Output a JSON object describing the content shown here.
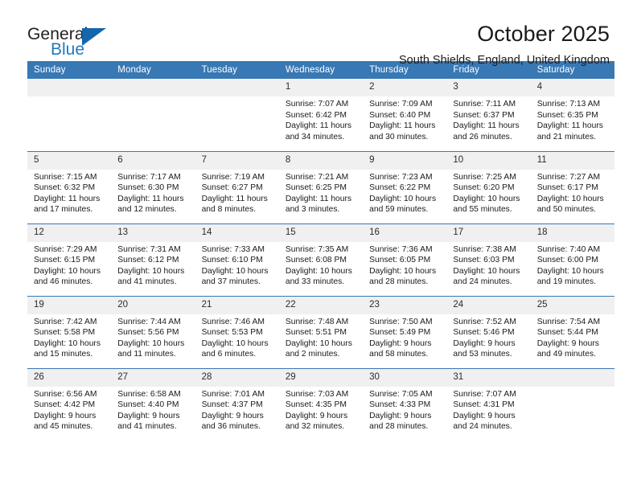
{
  "brand": {
    "name_top": "General",
    "name_bottom": "Blue",
    "accent_color": "#1567ab",
    "text_color": "#231f20"
  },
  "header": {
    "month_title": "October 2025",
    "location": "South Shields, England, United Kingdom"
  },
  "calendar": {
    "header_bg": "#3878b4",
    "header_text_color": "#ffffff",
    "daynumber_bg": "#f0f0f0",
    "weekdays": [
      "Sunday",
      "Monday",
      "Tuesday",
      "Wednesday",
      "Thursday",
      "Friday",
      "Saturday"
    ],
    "weeks": [
      [
        {
          "day": "",
          "empty": true
        },
        {
          "day": "",
          "empty": true
        },
        {
          "day": "",
          "empty": true
        },
        {
          "day": "1",
          "sunrise": "Sunrise: 7:07 AM",
          "sunset": "Sunset: 6:42 PM",
          "daylight": "Daylight: 11 hours and 34 minutes."
        },
        {
          "day": "2",
          "sunrise": "Sunrise: 7:09 AM",
          "sunset": "Sunset: 6:40 PM",
          "daylight": "Daylight: 11 hours and 30 minutes."
        },
        {
          "day": "3",
          "sunrise": "Sunrise: 7:11 AM",
          "sunset": "Sunset: 6:37 PM",
          "daylight": "Daylight: 11 hours and 26 minutes."
        },
        {
          "day": "4",
          "sunrise": "Sunrise: 7:13 AM",
          "sunset": "Sunset: 6:35 PM",
          "daylight": "Daylight: 11 hours and 21 minutes."
        }
      ],
      [
        {
          "day": "5",
          "sunrise": "Sunrise: 7:15 AM",
          "sunset": "Sunset: 6:32 PM",
          "daylight": "Daylight: 11 hours and 17 minutes."
        },
        {
          "day": "6",
          "sunrise": "Sunrise: 7:17 AM",
          "sunset": "Sunset: 6:30 PM",
          "daylight": "Daylight: 11 hours and 12 minutes."
        },
        {
          "day": "7",
          "sunrise": "Sunrise: 7:19 AM",
          "sunset": "Sunset: 6:27 PM",
          "daylight": "Daylight: 11 hours and 8 minutes."
        },
        {
          "day": "8",
          "sunrise": "Sunrise: 7:21 AM",
          "sunset": "Sunset: 6:25 PM",
          "daylight": "Daylight: 11 hours and 3 minutes."
        },
        {
          "day": "9",
          "sunrise": "Sunrise: 7:23 AM",
          "sunset": "Sunset: 6:22 PM",
          "daylight": "Daylight: 10 hours and 59 minutes."
        },
        {
          "day": "10",
          "sunrise": "Sunrise: 7:25 AM",
          "sunset": "Sunset: 6:20 PM",
          "daylight": "Daylight: 10 hours and 55 minutes."
        },
        {
          "day": "11",
          "sunrise": "Sunrise: 7:27 AM",
          "sunset": "Sunset: 6:17 PM",
          "daylight": "Daylight: 10 hours and 50 minutes."
        }
      ],
      [
        {
          "day": "12",
          "sunrise": "Sunrise: 7:29 AM",
          "sunset": "Sunset: 6:15 PM",
          "daylight": "Daylight: 10 hours and 46 minutes."
        },
        {
          "day": "13",
          "sunrise": "Sunrise: 7:31 AM",
          "sunset": "Sunset: 6:12 PM",
          "daylight": "Daylight: 10 hours and 41 minutes."
        },
        {
          "day": "14",
          "sunrise": "Sunrise: 7:33 AM",
          "sunset": "Sunset: 6:10 PM",
          "daylight": "Daylight: 10 hours and 37 minutes."
        },
        {
          "day": "15",
          "sunrise": "Sunrise: 7:35 AM",
          "sunset": "Sunset: 6:08 PM",
          "daylight": "Daylight: 10 hours and 33 minutes."
        },
        {
          "day": "16",
          "sunrise": "Sunrise: 7:36 AM",
          "sunset": "Sunset: 6:05 PM",
          "daylight": "Daylight: 10 hours and 28 minutes."
        },
        {
          "day": "17",
          "sunrise": "Sunrise: 7:38 AM",
          "sunset": "Sunset: 6:03 PM",
          "daylight": "Daylight: 10 hours and 24 minutes."
        },
        {
          "day": "18",
          "sunrise": "Sunrise: 7:40 AM",
          "sunset": "Sunset: 6:00 PM",
          "daylight": "Daylight: 10 hours and 19 minutes."
        }
      ],
      [
        {
          "day": "19",
          "sunrise": "Sunrise: 7:42 AM",
          "sunset": "Sunset: 5:58 PM",
          "daylight": "Daylight: 10 hours and 15 minutes."
        },
        {
          "day": "20",
          "sunrise": "Sunrise: 7:44 AM",
          "sunset": "Sunset: 5:56 PM",
          "daylight": "Daylight: 10 hours and 11 minutes."
        },
        {
          "day": "21",
          "sunrise": "Sunrise: 7:46 AM",
          "sunset": "Sunset: 5:53 PM",
          "daylight": "Daylight: 10 hours and 6 minutes."
        },
        {
          "day": "22",
          "sunrise": "Sunrise: 7:48 AM",
          "sunset": "Sunset: 5:51 PM",
          "daylight": "Daylight: 10 hours and 2 minutes."
        },
        {
          "day": "23",
          "sunrise": "Sunrise: 7:50 AM",
          "sunset": "Sunset: 5:49 PM",
          "daylight": "Daylight: 9 hours and 58 minutes."
        },
        {
          "day": "24",
          "sunrise": "Sunrise: 7:52 AM",
          "sunset": "Sunset: 5:46 PM",
          "daylight": "Daylight: 9 hours and 53 minutes."
        },
        {
          "day": "25",
          "sunrise": "Sunrise: 7:54 AM",
          "sunset": "Sunset: 5:44 PM",
          "daylight": "Daylight: 9 hours and 49 minutes."
        }
      ],
      [
        {
          "day": "26",
          "sunrise": "Sunrise: 6:56 AM",
          "sunset": "Sunset: 4:42 PM",
          "daylight": "Daylight: 9 hours and 45 minutes."
        },
        {
          "day": "27",
          "sunrise": "Sunrise: 6:58 AM",
          "sunset": "Sunset: 4:40 PM",
          "daylight": "Daylight: 9 hours and 41 minutes."
        },
        {
          "day": "28",
          "sunrise": "Sunrise: 7:01 AM",
          "sunset": "Sunset: 4:37 PM",
          "daylight": "Daylight: 9 hours and 36 minutes."
        },
        {
          "day": "29",
          "sunrise": "Sunrise: 7:03 AM",
          "sunset": "Sunset: 4:35 PM",
          "daylight": "Daylight: 9 hours and 32 minutes."
        },
        {
          "day": "30",
          "sunrise": "Sunrise: 7:05 AM",
          "sunset": "Sunset: 4:33 PM",
          "daylight": "Daylight: 9 hours and 28 minutes."
        },
        {
          "day": "31",
          "sunrise": "Sunrise: 7:07 AM",
          "sunset": "Sunset: 4:31 PM",
          "daylight": "Daylight: 9 hours and 24 minutes."
        },
        {
          "day": "",
          "empty": true
        }
      ]
    ]
  }
}
